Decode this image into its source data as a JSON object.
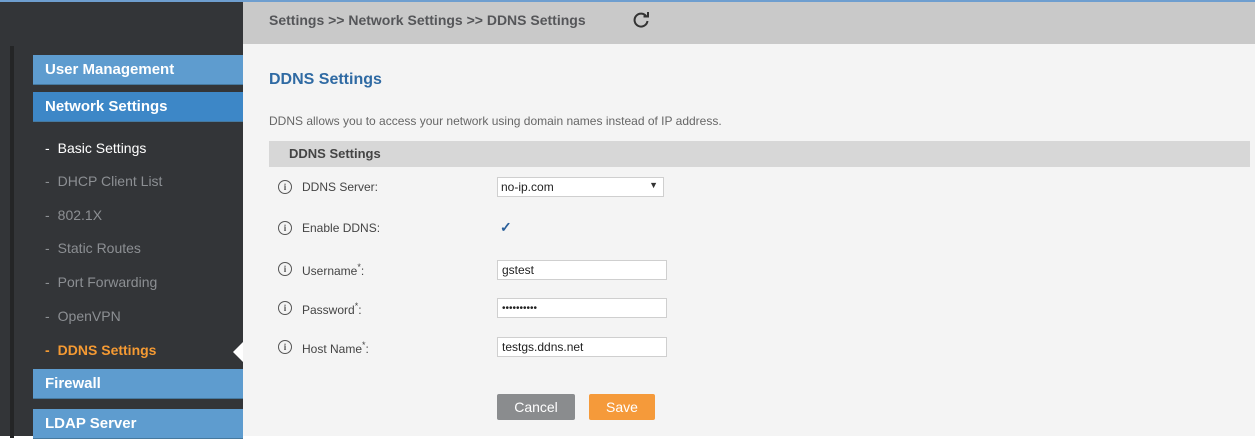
{
  "breadcrumb": "Settings >> Network Settings >> DDNS Settings",
  "sidebar": {
    "main_items": [
      {
        "label": "User Management"
      },
      {
        "label": "Network Settings"
      },
      {
        "label": "Firewall"
      },
      {
        "label": "LDAP Server"
      }
    ],
    "dash": "-",
    "sub_items": [
      {
        "label": "Basic Settings"
      },
      {
        "label": "DHCP Client List"
      },
      {
        "label": "802.1X"
      },
      {
        "label": "Static Routes"
      },
      {
        "label": "Port Forwarding"
      },
      {
        "label": "OpenVPN"
      },
      {
        "label": "DDNS Settings"
      }
    ]
  },
  "page": {
    "title": "DDNS Settings",
    "description": "DDNS allows you to access your network using domain names instead of IP address.",
    "section_title": "DDNS Settings"
  },
  "form": {
    "info_glyph": "i",
    "required_mark": "*",
    "colon": ":",
    "ddns_server": {
      "label": "DDNS Server:",
      "value": "no-ip.com"
    },
    "enable_ddns": {
      "label": "Enable DDNS:",
      "checked": true
    },
    "username": {
      "label": "Username",
      "value": "gstest"
    },
    "password": {
      "label": "Password",
      "value": "••••••••••"
    },
    "host_name": {
      "label": "Host Name",
      "value": "testgs.ddns.net"
    }
  },
  "buttons": {
    "cancel": "Cancel",
    "save": "Save"
  },
  "colors": {
    "accent_blue": "#3d87c7",
    "active_orange": "#f59a33",
    "title_blue": "#2f6aa3"
  }
}
